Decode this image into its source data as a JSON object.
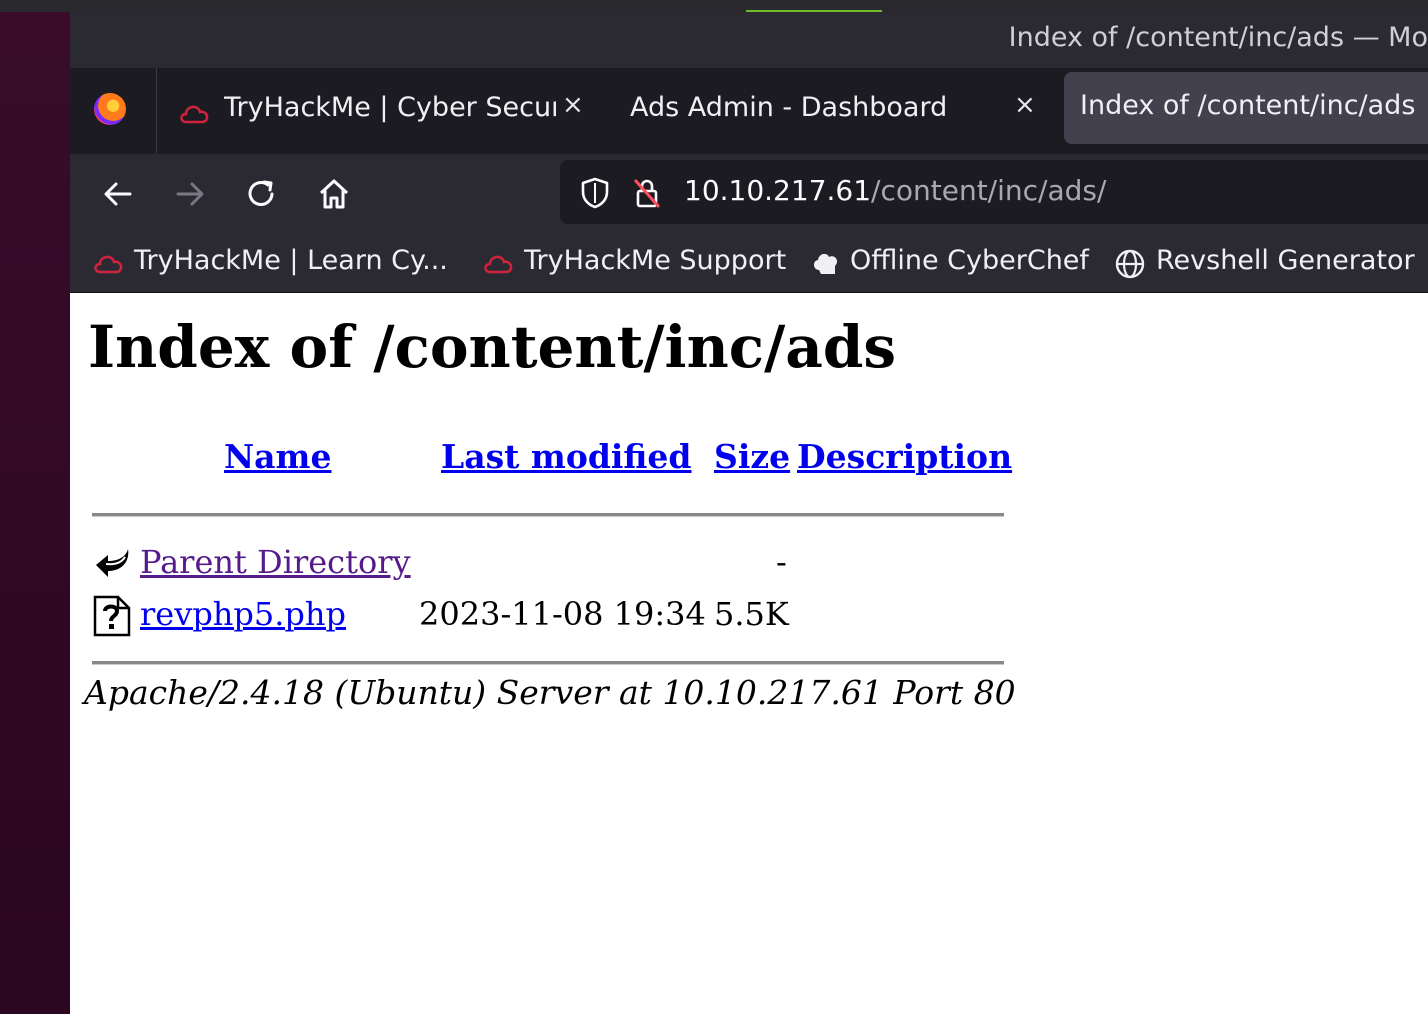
{
  "window": {
    "title": "Index of /content/inc/ads — Mo"
  },
  "tabs": [
    {
      "label": "TryHackMe | Cyber Securi",
      "close": "×"
    },
    {
      "label": "Ads Admin - Dashboard",
      "close": "×"
    },
    {
      "label": "Index of /content/inc/ads"
    }
  ],
  "url": {
    "host": "10.10.217.61",
    "path": "/content/inc/ads/"
  },
  "bookmarks": [
    {
      "label": "TryHackMe | Learn Cy...",
      "icon": "tryhackme-icon"
    },
    {
      "label": "TryHackMe Support",
      "icon": "tryhackme-icon"
    },
    {
      "label": "Offline CyberChef",
      "icon": "chef-hat-icon"
    },
    {
      "label": "Revshell Generator",
      "icon": "globe-icon"
    }
  ],
  "page": {
    "heading": "Index of /content/inc/ads",
    "columns": {
      "name": "Name",
      "modified": "Last modified",
      "size": "Size",
      "description": "Description"
    },
    "rows": [
      {
        "name": "Parent Directory",
        "modified": "",
        "size": "-",
        "icon": "back-arrow-icon"
      },
      {
        "name": "revphp5.php",
        "modified": "2023-11-08 19:34",
        "size": "5.5K",
        "icon": "unknown-file-icon"
      }
    ],
    "footer": "Apache/2.4.18 (Ubuntu) Server at 10.10.217.61 Port 80"
  },
  "colors": {
    "link": "#0000ee",
    "visited": "#551a8b",
    "chrome": "#2b2a33",
    "tabbar": "#1c1b22"
  }
}
